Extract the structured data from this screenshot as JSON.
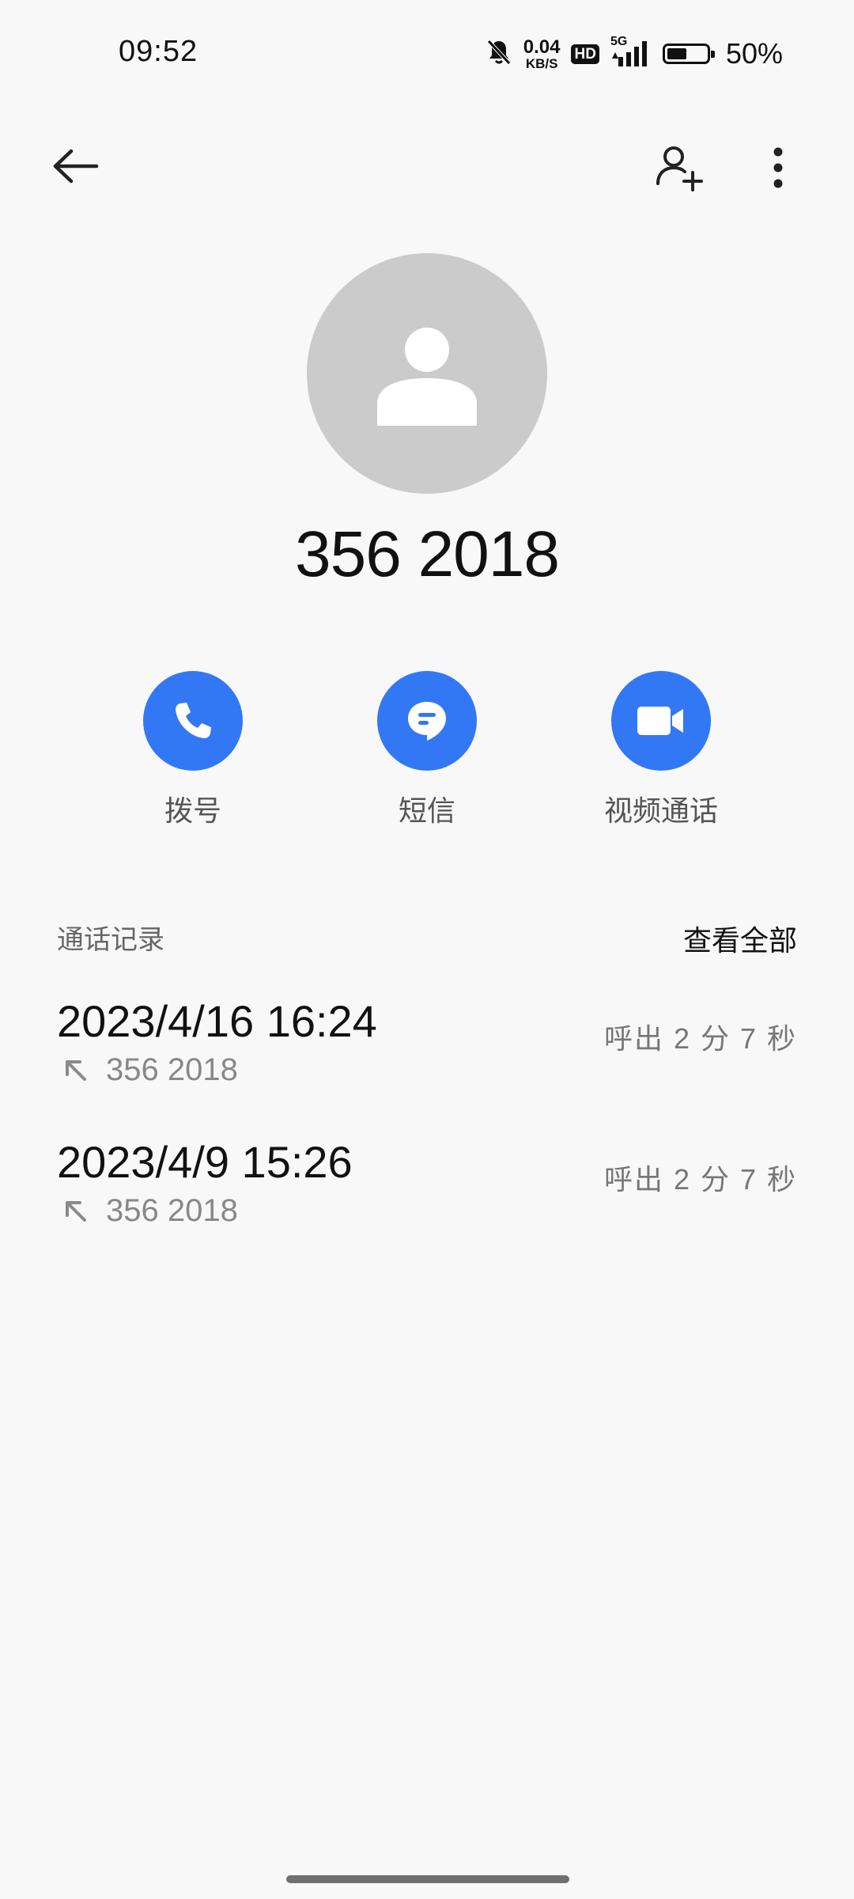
{
  "status_bar": {
    "time": "09:52",
    "net_speed_value": "0.04",
    "net_speed_unit": "KB/S",
    "hd_label": "HD",
    "network_type": "5G",
    "battery_percent": "50%",
    "battery_level": 0.5
  },
  "contact": {
    "number": "356 2018"
  },
  "actions": [
    {
      "label": "拨号",
      "icon": "phone-icon"
    },
    {
      "label": "短信",
      "icon": "message-icon"
    },
    {
      "label": "视频通话",
      "icon": "video-icon"
    }
  ],
  "call_log": {
    "title": "通话记录",
    "view_all": "查看全部",
    "entries": [
      {
        "datetime": "2023/4/16 16:24",
        "number": "356 2018",
        "meta": "呼出 2 分 7 秒",
        "direction": "outgoing"
      },
      {
        "datetime": "2023/4/9 15:26",
        "number": "356 2018",
        "meta": "呼出 2 分 7 秒",
        "direction": "outgoing"
      }
    ]
  },
  "colors": {
    "accent": "#3278f5",
    "background": "#f8f8f8",
    "avatar_bg": "#cbcbcb"
  }
}
